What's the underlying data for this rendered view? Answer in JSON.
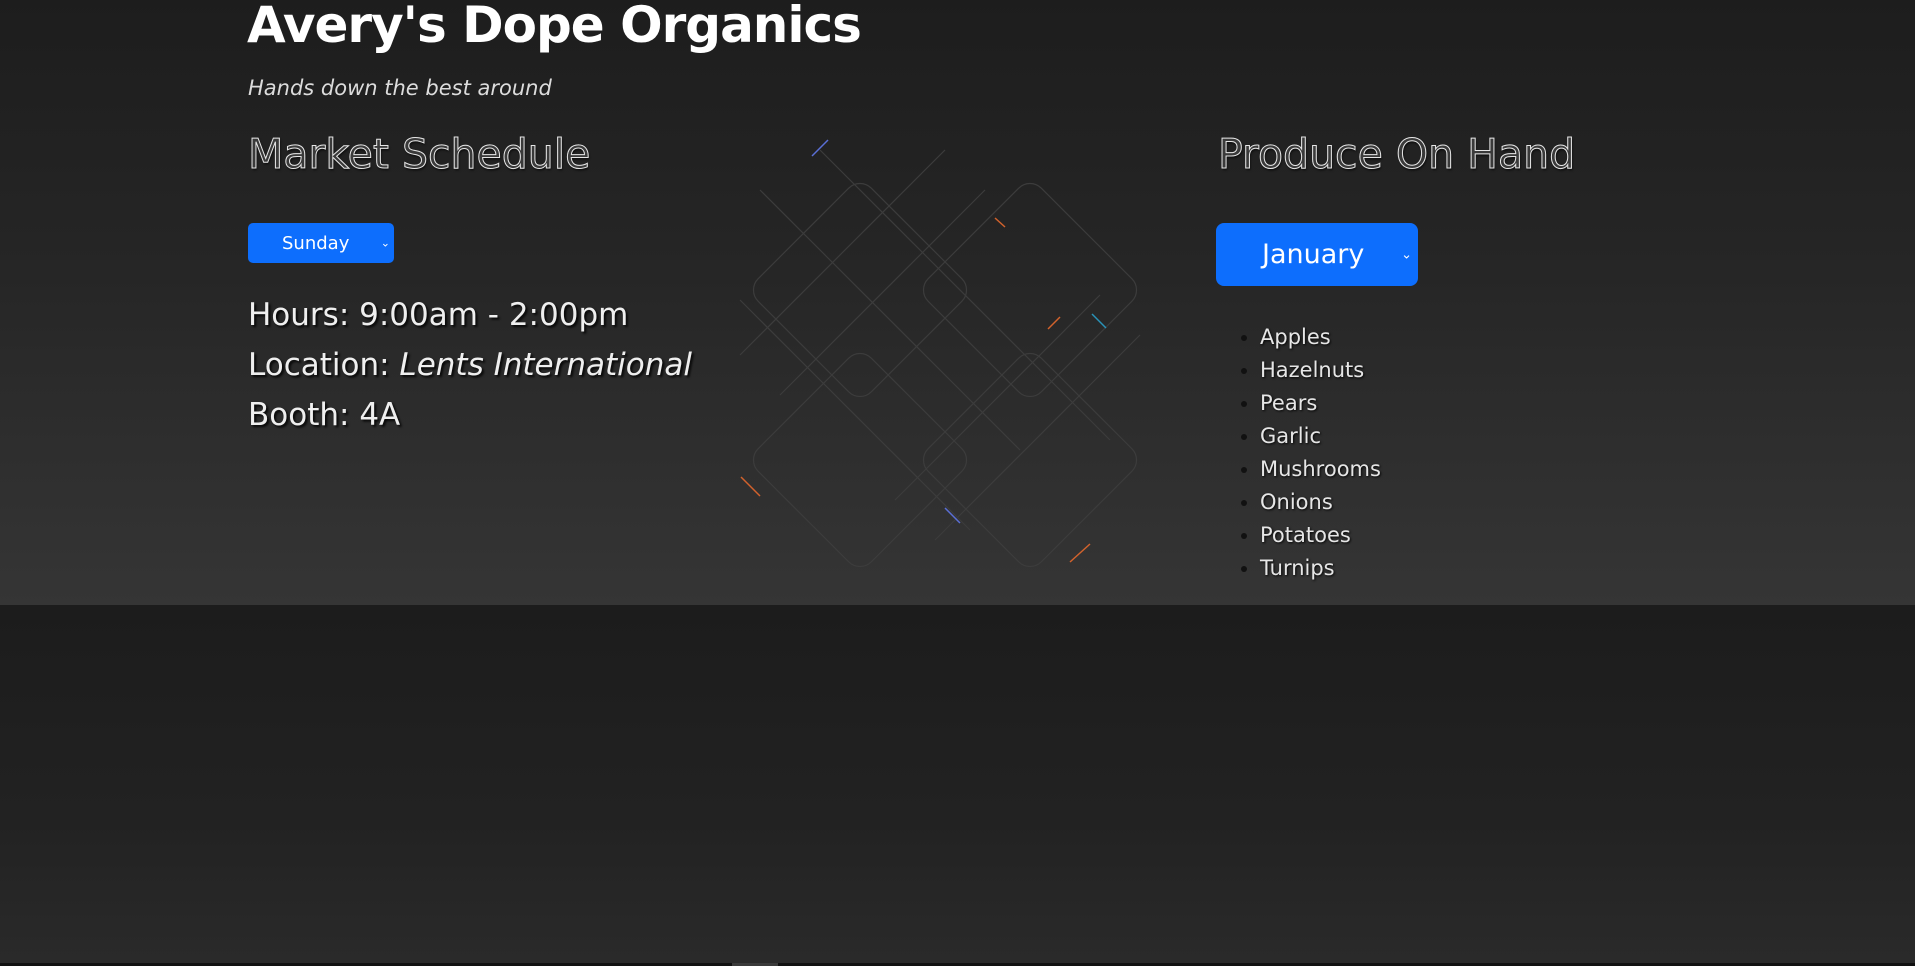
{
  "header": {
    "title": "Avery's Dope Organics",
    "tagline": "Hands down the best around"
  },
  "schedule": {
    "heading": "Market Schedule",
    "day_select": {
      "selected": "Sunday",
      "icon": "chevron-down-icon"
    },
    "hours_label": "Hours:",
    "hours_value": "9:00am - 2:00pm",
    "location_label": "Location:",
    "location_value": "Lents International",
    "booth_label": "Booth:",
    "booth_value": "4A"
  },
  "produce": {
    "heading": "Produce On Hand",
    "month_select": {
      "selected": "January",
      "icon": "chevron-down-icon"
    },
    "items": [
      "Apples",
      "Hazelnuts",
      "Pears",
      "Garlic",
      "Mushrooms",
      "Onions",
      "Potatoes",
      "Turnips"
    ]
  },
  "colors": {
    "accent": "#0d6efd",
    "background": "#1f1f1f",
    "text": "#ffffff"
  }
}
